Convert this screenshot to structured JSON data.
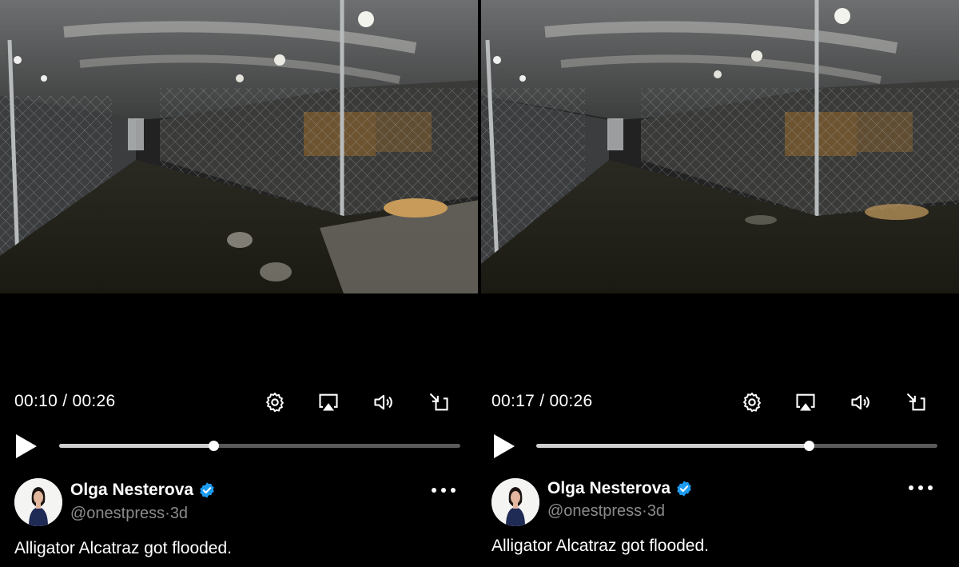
{
  "colors": {
    "background": "#000000",
    "handle": "#8b8b8b",
    "verified": "#1d9bf0",
    "track": "#5a5a5a",
    "track_fill": "#cfcfcf"
  },
  "panels": [
    {
      "video": {
        "current_time": "00:10",
        "separator": " / ",
        "duration": "00:26",
        "progress": 0.385
      },
      "controls": [
        "settings-icon",
        "airplay-icon",
        "volume-icon",
        "exit-fullscreen-icon"
      ],
      "author": {
        "name": "Olga Nesterova",
        "handle": "@onestpress",
        "dot": "·",
        "age": "3d"
      },
      "text": "Alligator Alcatraz got flooded."
    },
    {
      "video": {
        "current_time": "00:17",
        "separator": " / ",
        "duration": "00:26",
        "progress": 0.68
      },
      "controls": [
        "settings-icon",
        "airplay-icon",
        "volume-icon",
        "exit-fullscreen-icon"
      ],
      "author": {
        "name": "Olga Nesterova",
        "handle": "@onestpress",
        "dot": "·",
        "age": "3d"
      },
      "text": "Alligator Alcatraz got flooded."
    }
  ]
}
